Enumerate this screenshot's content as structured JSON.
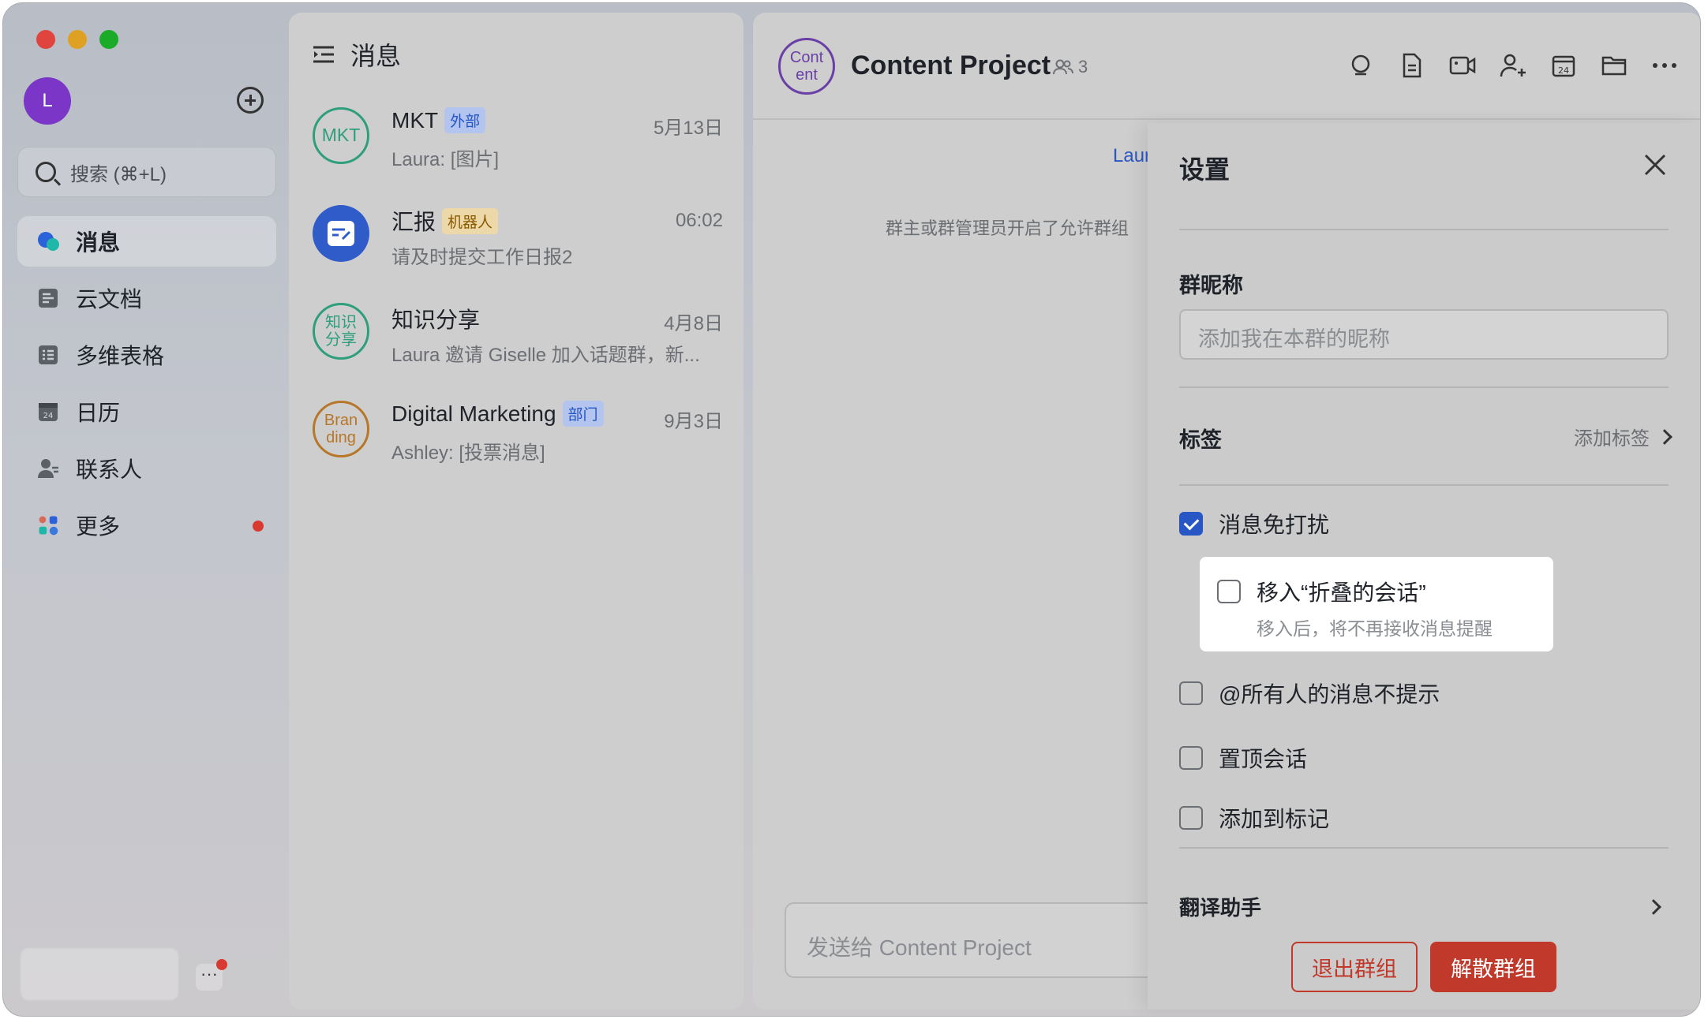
{
  "sidebar": {
    "user_initial": "L",
    "search_placeholder": "搜索 (⌘+L)",
    "nav": [
      {
        "label": "消息",
        "icon": "chat-bubble-icon",
        "active": true
      },
      {
        "label": "云文档",
        "icon": "cloud-doc-icon"
      },
      {
        "label": "多维表格",
        "icon": "table-icon"
      },
      {
        "label": "日历",
        "icon": "calendar-icon"
      },
      {
        "label": "联系人",
        "icon": "contacts-icon"
      },
      {
        "label": "更多",
        "icon": "more-apps-icon",
        "badge_dot": true
      }
    ],
    "more_mini": "···"
  },
  "list": {
    "title": "消息",
    "conversations": [
      {
        "avatar_text": "MKT",
        "name": "MKT",
        "tag": "外部",
        "time": "5月13日",
        "preview": "Laura: [图片]"
      },
      {
        "avatar_text": "",
        "name": "汇报",
        "tag": "机器人",
        "time": "06:02",
        "preview": "请及时提交工作日报2"
      },
      {
        "avatar_text": "知识\n分享",
        "name": "知识分享",
        "tag": "",
        "time": "4月8日",
        "preview": "Laura 邀请 Giselle 加入话题群，新..."
      },
      {
        "avatar_text": "Bran\nding",
        "name": "Digital Marketing",
        "tag": "部门",
        "time": "9月3日",
        "preview": "Ashley: [投票消息]"
      }
    ]
  },
  "chat": {
    "avatar_text": "Cont\nent",
    "title": "Content Project",
    "member_count": "3",
    "system_name": "Laur",
    "system_message": "群主或群管理员开启了允许群组",
    "input_placeholder": "发送给 Content Project",
    "tools": [
      "search-icon",
      "doc-icon",
      "video-icon",
      "add-member-icon",
      "calendar-icon",
      "folder-icon",
      "more-icon"
    ]
  },
  "settings": {
    "title": "设置",
    "nickname_label": "群昵称",
    "nickname_placeholder": "添加我在本群的昵称",
    "tags_label": "标签",
    "tags_action": "添加标签",
    "dnd_label": "消息免打扰",
    "dnd_checked": true,
    "fold_label": "移入“折叠的会话”",
    "fold_sub": "移入后，将不再接收消息提醒",
    "fold_checked": false,
    "at_all_label": "@所有人的消息不提示",
    "at_all_checked": false,
    "pin_label": "置顶会话",
    "pin_checked": false,
    "mark_label": "添加到标记",
    "mark_checked": false,
    "translate_label": "翻译助手",
    "leave_button": "退出群组",
    "dissolve_button": "解散群组"
  }
}
